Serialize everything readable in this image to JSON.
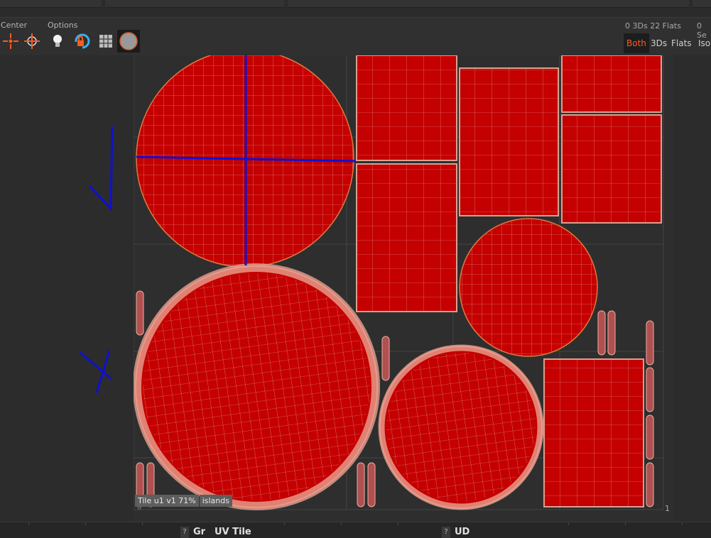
{
  "toolbar": {
    "center_label": "Center",
    "options_label": "Options",
    "counts_left": "0 3Ds 22 Flats",
    "counts_right": "0 Se",
    "modes": [
      "Both",
      "3Ds",
      "Flats",
      "Isol"
    ]
  },
  "canvas": {
    "corner_label": "1",
    "origin_label": "0"
  },
  "status": {
    "tile": "Tile u1 v1 71%",
    "islands": "islands"
  },
  "bottom": {
    "q1": "?",
    "side_label": "Gr",
    "title": "UV Tile",
    "q2": "?",
    "side_label2": "UD"
  },
  "colors": {
    "island_fill": "#c40000",
    "island_edge": "#e2a090",
    "annotation": "#1010d0",
    "active_mode": "#ff5a1f"
  }
}
